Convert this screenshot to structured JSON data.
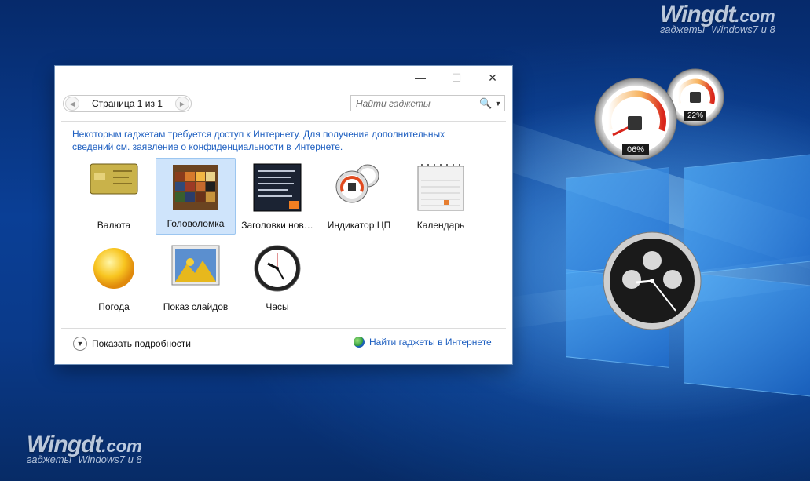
{
  "watermark": {
    "brand": "Wingdt",
    "dotcom": ".com",
    "sub_left": "гаджеты",
    "sub_right": "Windows7 и 8"
  },
  "window": {
    "controls": {
      "minimize": "—",
      "maximize": "☐",
      "close": "✕"
    },
    "pager": {
      "text": "Страница 1 из 1",
      "prev": "◀",
      "next": "▶"
    },
    "search": {
      "placeholder": "Найти гаджеты",
      "icon": "🔍",
      "dropdown": "▼"
    },
    "notice": "Некоторым гаджетам требуется доступ к Интернету. Для получения дополнительных сведений см. заявление о конфиденциальности в Интернете.",
    "gadgets": [
      {
        "label": "Валюта",
        "icon": "currency-icon"
      },
      {
        "label": "Головоломка",
        "icon": "puzzle-icon",
        "selected": true
      },
      {
        "label": "Заголовки нов…",
        "icon": "headlines-icon"
      },
      {
        "label": "Индикатор ЦП",
        "icon": "cpu-meter-icon"
      },
      {
        "label": "Календарь",
        "icon": "calendar-icon"
      },
      {
        "label": "Погода",
        "icon": "weather-icon"
      },
      {
        "label": "Показ слайдов",
        "icon": "slideshow-icon"
      },
      {
        "label": "Часы",
        "icon": "clock-icon"
      }
    ],
    "show_details": "Показать подробности",
    "find_online": "Найти гаджеты в Интернете"
  },
  "desktop": {
    "cpu_meter": {
      "cpu_percent": "06%",
      "memory_percent": "22%"
    }
  }
}
